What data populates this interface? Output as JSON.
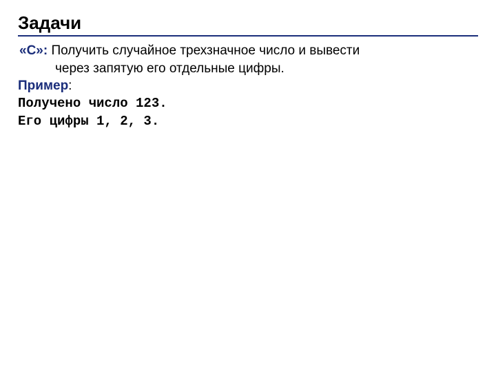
{
  "heading": "Задачи",
  "task": {
    "label": "«C»:",
    "line1": " Получить случайное трехзначное число и вывести",
    "line2": "через запятую его отдельные цифры."
  },
  "example": {
    "label": "Пример",
    "colon": ":",
    "line1": "Получено число 123.",
    "line2": "Его цифры 1, 2, 3."
  }
}
